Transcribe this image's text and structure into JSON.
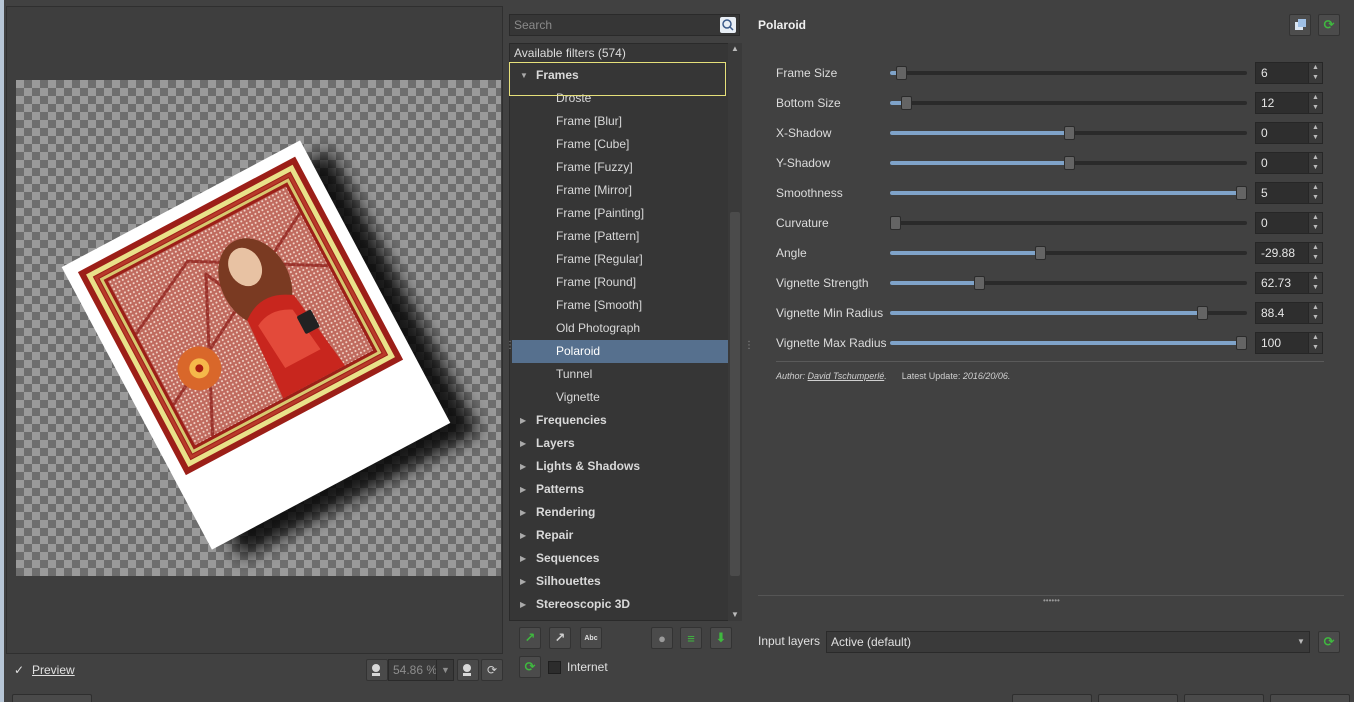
{
  "preview": {
    "checkbox_mark": "✓",
    "label": "Preview",
    "zoom_value": "54.86 %"
  },
  "filters": {
    "search_placeholder": "Search",
    "header": "Available filters (574)",
    "tree": [
      {
        "label": "Frames",
        "type": "category",
        "expanded": true
      },
      {
        "label": "Droste",
        "type": "item"
      },
      {
        "label": "Frame [Blur]",
        "type": "item"
      },
      {
        "label": "Frame [Cube]",
        "type": "item"
      },
      {
        "label": "Frame [Fuzzy]",
        "type": "item"
      },
      {
        "label": "Frame [Mirror]",
        "type": "item"
      },
      {
        "label": "Frame [Painting]",
        "type": "item"
      },
      {
        "label": "Frame [Pattern]",
        "type": "item"
      },
      {
        "label": "Frame [Regular]",
        "type": "item"
      },
      {
        "label": "Frame [Round]",
        "type": "item"
      },
      {
        "label": "Frame [Smooth]",
        "type": "item"
      },
      {
        "label": "Old Photograph",
        "type": "item"
      },
      {
        "label": "Polaroid",
        "type": "item",
        "selected": true
      },
      {
        "label": "Tunnel",
        "type": "item"
      },
      {
        "label": "Vignette",
        "type": "item"
      },
      {
        "label": "Frequencies",
        "type": "category"
      },
      {
        "label": "Layers",
        "type": "category"
      },
      {
        "label": "Lights & Shadows",
        "type": "category"
      },
      {
        "label": "Patterns",
        "type": "category"
      },
      {
        "label": "Rendering",
        "type": "category"
      },
      {
        "label": "Repair",
        "type": "category"
      },
      {
        "label": "Sequences",
        "type": "category"
      },
      {
        "label": "Silhouettes",
        "type": "category"
      },
      {
        "label": "Stereoscopic 3D",
        "type": "category"
      }
    ],
    "internet_label": "Internet"
  },
  "params": {
    "title": "Polaroid",
    "items": [
      {
        "label": "Frame Size",
        "value": "6",
        "level": 0.03
      },
      {
        "label": "Bottom Size",
        "value": "12",
        "level": 0.045
      },
      {
        "label": "X-Shadow",
        "value": "0",
        "level": 0.5
      },
      {
        "label": "Y-Shadow",
        "value": "0",
        "level": 0.5
      },
      {
        "label": "Smoothness",
        "value": "5",
        "level": 0.985
      },
      {
        "label": "Curvature",
        "value": "0",
        "level": 0.015
      },
      {
        "label": "Angle",
        "value": "-29.88",
        "level": 0.42
      },
      {
        "label": "Vignette Strength",
        "value": "62.73",
        "level": 0.25
      },
      {
        "label": "Vignette Min Radius",
        "value": "88.4",
        "level": 0.875
      },
      {
        "label": "Vignette Max Radius",
        "value": "100",
        "level": 0.985
      }
    ],
    "author_prefix": "Author:",
    "author_name": "David Tschumperlé",
    "author_suffix": ".",
    "update_label": "Latest Update:",
    "update_date": "2016/20/06."
  },
  "input_layers": {
    "label": "Input layers",
    "value": "Active (default)"
  },
  "colors": {
    "selection": "#56708e",
    "slider_fill": "#7fa3c9",
    "highlight_box": "#e6e07a"
  }
}
